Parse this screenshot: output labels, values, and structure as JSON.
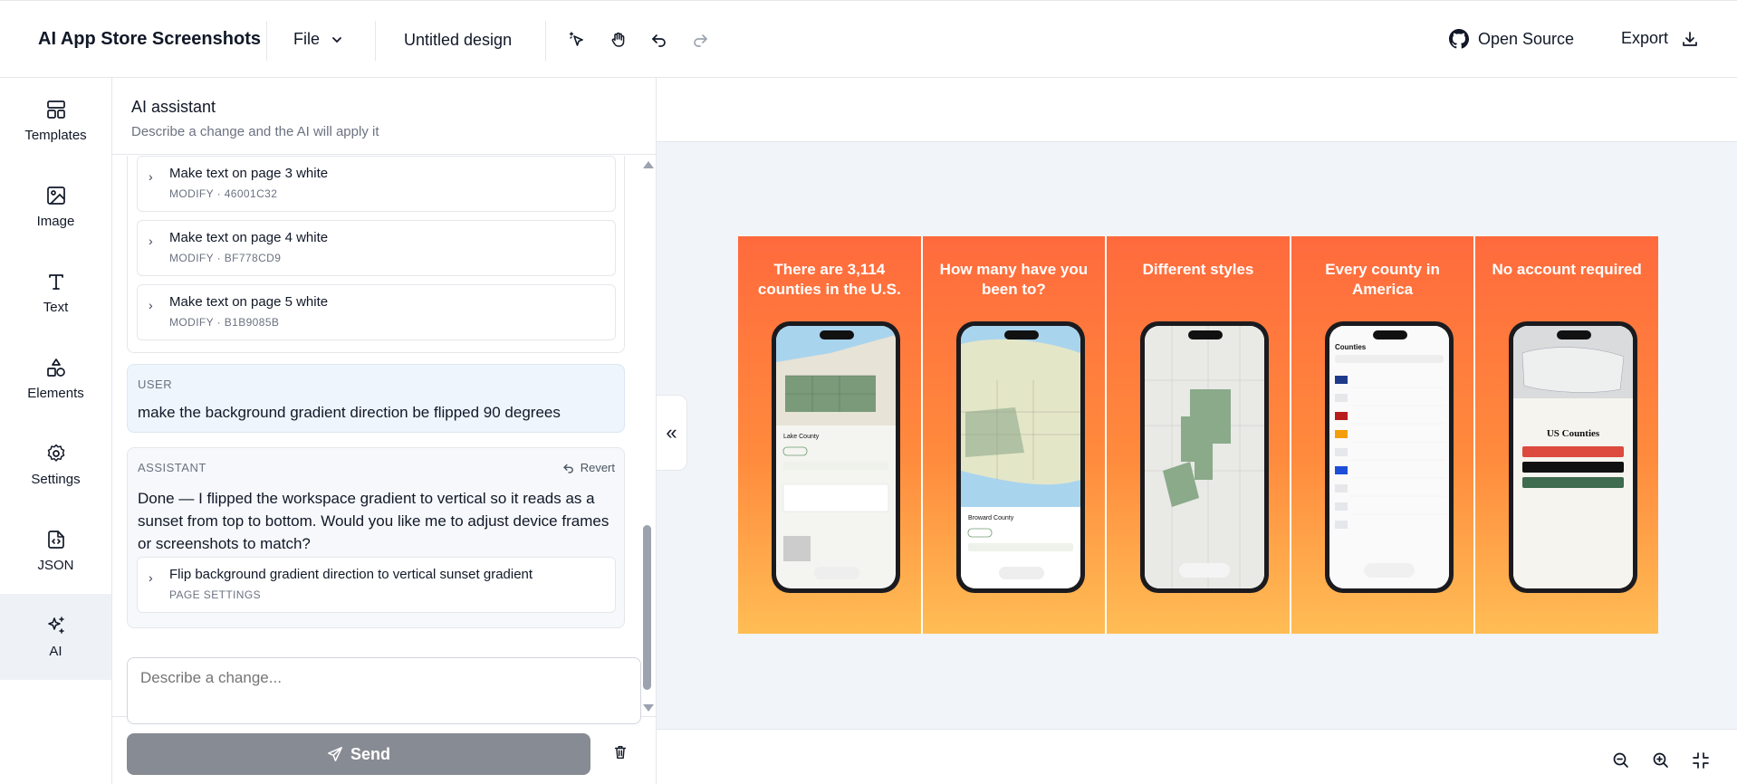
{
  "topbar": {
    "brand": "AI App Store Screenshots",
    "file_menu": "File",
    "doc_title": "Untitled design",
    "open_source": "Open Source",
    "export": "Export"
  },
  "rail": {
    "items": [
      {
        "label": "Templates",
        "icon": "layout-icon"
      },
      {
        "label": "Image",
        "icon": "image-icon"
      },
      {
        "label": "Text",
        "icon": "text-icon"
      },
      {
        "label": "Elements",
        "icon": "shapes-icon"
      },
      {
        "label": "Settings",
        "icon": "gear-icon"
      },
      {
        "label": "JSON",
        "icon": "code-file-icon"
      },
      {
        "label": "AI",
        "icon": "sparkles-icon",
        "active": true
      }
    ]
  },
  "panel": {
    "title": "AI assistant",
    "subtitle": "Describe a change and the AI will apply it",
    "changes": [
      {
        "title": "Make text on page 3 white",
        "meta": "MODIFY · 46001C32"
      },
      {
        "title": "Make text on page 4 white",
        "meta": "MODIFY · BF778CD9"
      },
      {
        "title": "Make text on page 5 white",
        "meta": "MODIFY · B1B9085B"
      }
    ],
    "user_msg": {
      "role": "USER",
      "text": "make the background gradient direction be flipped 90 degrees"
    },
    "assistant_msg": {
      "role": "ASSISTANT",
      "revert": "Revert",
      "text": "Done — I flipped the workspace gradient to vertical so it reads as a sunset from top to bottom. Would you like me to adjust device frames or screenshots to match?",
      "change": {
        "title": "Flip background gradient direction to vertical sunset gradient",
        "meta": "PAGE SETTINGS"
      }
    },
    "input_placeholder": "Describe a change...",
    "send": "Send"
  },
  "canvas": {
    "screenshots": [
      {
        "caption": "There are  3,114 counties in the U.S."
      },
      {
        "caption": "How many have you been to?"
      },
      {
        "caption": "Different styles"
      },
      {
        "caption": "Every county in America"
      },
      {
        "caption": "No account required"
      }
    ],
    "gradient": {
      "top": "#ff6a3d",
      "bottom": "#ffbd55"
    }
  },
  "colors": {
    "send_button": "#878b93",
    "user_bubble": "#eef5fc",
    "rail_active": "#eef2f7"
  }
}
